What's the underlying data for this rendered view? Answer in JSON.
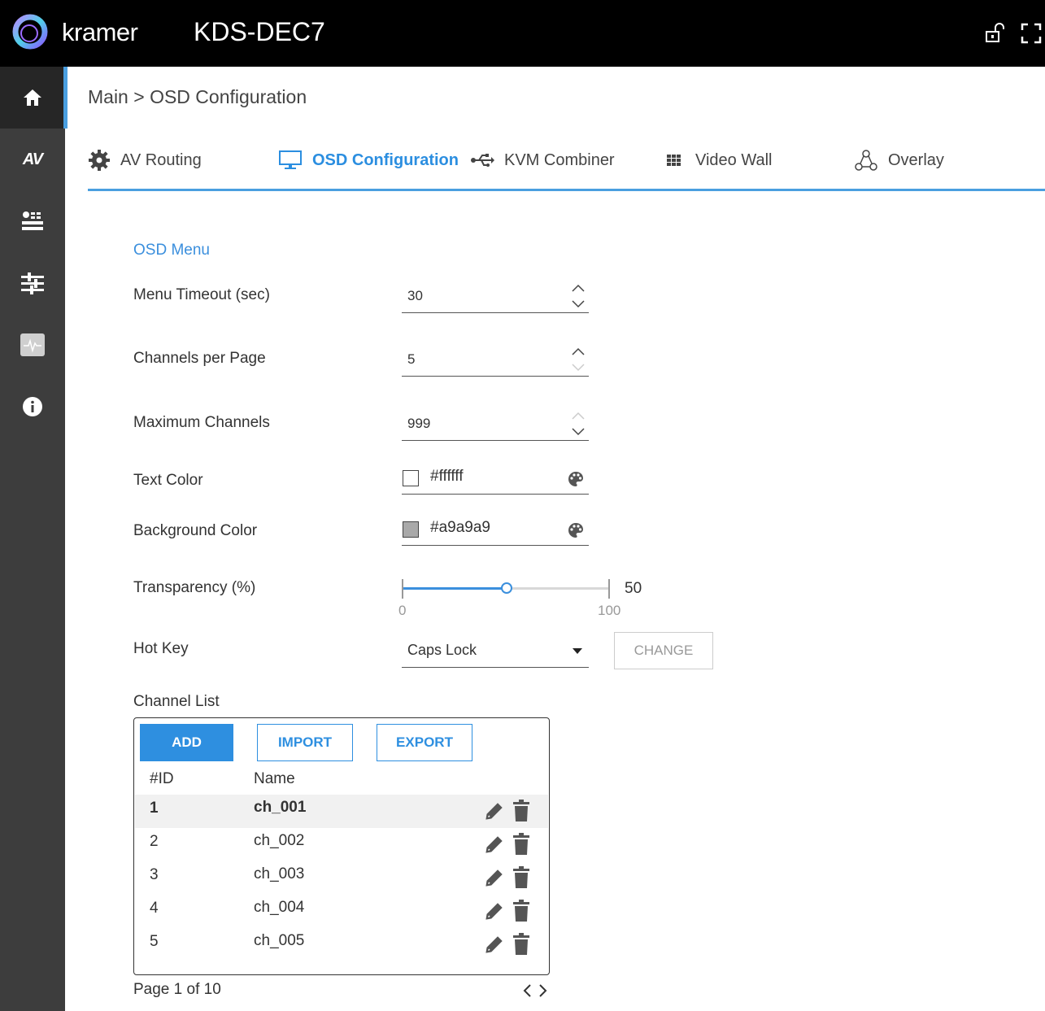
{
  "header": {
    "brand": "kramer",
    "model": "KDS-DEC7",
    "icons": [
      "lock-open-icon",
      "fullscreen-icon"
    ]
  },
  "sidebar": {
    "items": [
      {
        "icon": "home-icon",
        "active": true
      },
      {
        "label": "AV"
      },
      {
        "icon": "device-settings-icon"
      },
      {
        "icon": "sliders-icon"
      },
      {
        "icon": "diagnostics-icon"
      },
      {
        "icon": "info-icon"
      }
    ]
  },
  "breadcrumb": "Main > OSD Configuration",
  "tabs": [
    {
      "label": "AV Routing",
      "icon": "gear-icon"
    },
    {
      "label": "OSD Configuration",
      "icon": "monitor-icon",
      "active": true
    },
    {
      "label": "KVM Combiner",
      "icon": "usb-icon"
    },
    {
      "label": "Video Wall",
      "icon": "grid-icon"
    },
    {
      "label": "Overlay",
      "icon": "overlay-icon"
    }
  ],
  "osd": {
    "section_title": "OSD Menu",
    "menu_timeout": {
      "label": "Menu Timeout (sec)",
      "value": "30"
    },
    "channels_per_page": {
      "label": "Channels per Page",
      "value": "5"
    },
    "maximum_channels": {
      "label": "Maximum Channels",
      "value": "999"
    },
    "text_color": {
      "label": "Text Color",
      "value": "#ffffff",
      "swatch": "#ffffff"
    },
    "background_color": {
      "label": "Background Color",
      "value": "#a9a9a9",
      "swatch": "#a9a9a9"
    },
    "transparency": {
      "label": "Transparency (%)",
      "value": "50",
      "min": "0",
      "max": "100",
      "level": 0.5
    },
    "hot_key": {
      "label": "Hot Key",
      "value": "Caps Lock",
      "change_label": "CHANGE"
    }
  },
  "channel_list": {
    "title": "Channel List",
    "add_label": "ADD",
    "import_label": "IMPORT",
    "export_label": "EXPORT",
    "col_id": "#ID",
    "col_name": "Name",
    "rows": [
      {
        "id": "1",
        "name": "ch_001"
      },
      {
        "id": "2",
        "name": "ch_002"
      },
      {
        "id": "3",
        "name": "ch_003"
      },
      {
        "id": "4",
        "name": "ch_004"
      },
      {
        "id": "5",
        "name": "ch_005"
      }
    ],
    "pager": "Page 1 of 10"
  },
  "colors": {
    "accent": "#2e8fe0",
    "sidebar": "#3d3d3d",
    "topbar": "#000000"
  }
}
